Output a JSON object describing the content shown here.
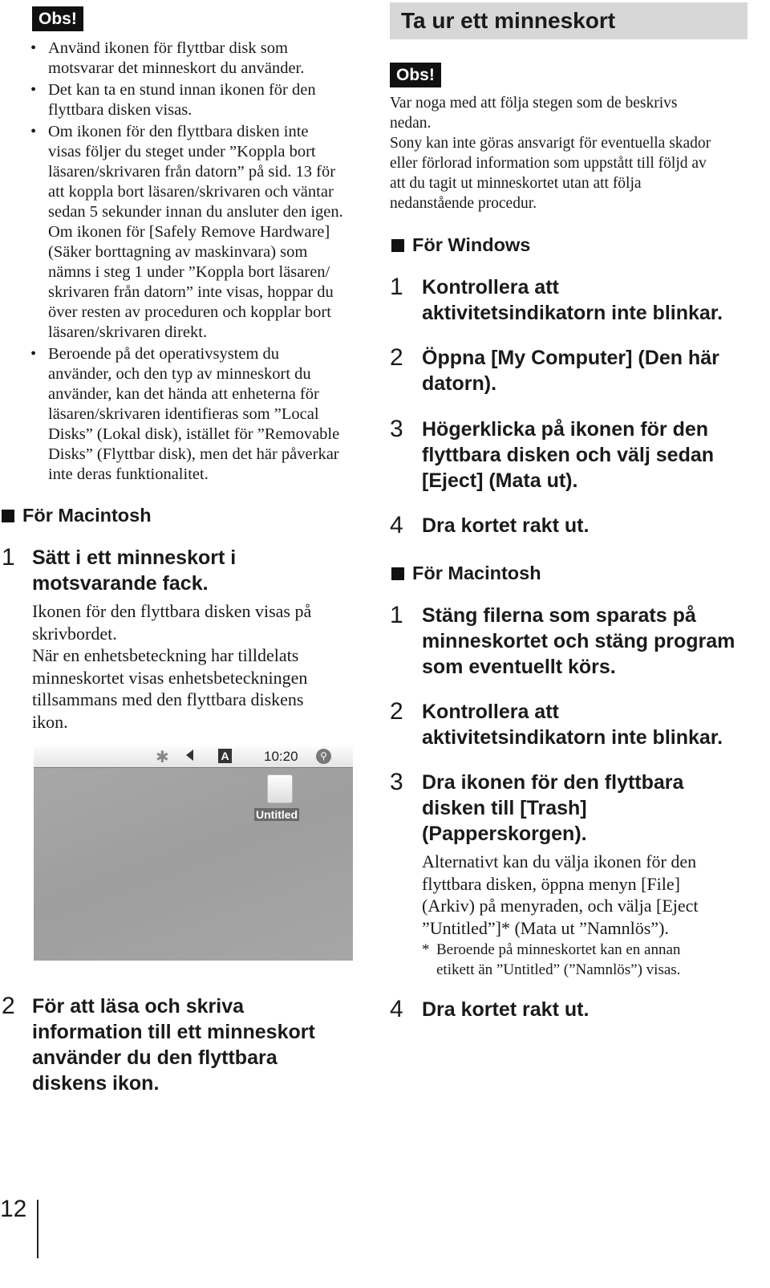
{
  "left": {
    "obs_label": "Obs!",
    "bullets": [
      [
        "Använd ikonen för flyttbar disk som",
        "motsvarar det minneskort du använder."
      ],
      [
        "Det kan ta en stund innan ikonen för den",
        "flyttbara disken visas."
      ],
      [
        "Om ikonen för den flyttbara disken inte",
        "visas följer du steget under ”Koppla bort",
        "läsaren/skrivaren från datorn” på sid. 13 för",
        "att koppla bort läsaren/skrivaren och väntar",
        "sedan 5 sekunder innan du ansluter den igen.",
        "Om ikonen för [Safely Remove Hardware]",
        "(Säker borttagning av maskinvara) som",
        "nämns i steg 1 under ”Koppla bort läsaren/",
        "skrivaren från datorn” inte visas, hoppar du",
        "över resten av proceduren och kopplar bort",
        "läsaren/skrivaren direkt."
      ],
      [
        "Beroende på det operativsystem du",
        "använder, och den typ av minneskort du",
        "använder, kan det hända att enheterna för",
        "läsaren/skrivaren identifieras som ”Local",
        "Disks” (Lokal disk), istället för ”Removable",
        "Disks” (Flyttbar disk), men det här påverkar",
        "inte deras funktionalitet."
      ]
    ],
    "mac_heading": "För Macintosh",
    "step1": {
      "num": "1",
      "title": [
        "Sätt i ett minneskort i",
        "motsvarande fack."
      ],
      "body": [
        "Ikonen för den flyttbara disken visas på",
        "skrivbordet.",
        "När en enhetsbeteckning har tilldelats",
        "minneskortet visas enhetsbeteckningen",
        "tillsammans med den flyttbara diskens",
        "ikon."
      ]
    },
    "screenshot": {
      "clock": "10:20",
      "input_menu": "A",
      "disk_label": "Untitled"
    },
    "step2": {
      "num": "2",
      "title": [
        "För att läsa och skriva",
        "information till ett minneskort",
        "använder du den flyttbara",
        "diskens ikon."
      ]
    }
  },
  "right": {
    "header": "Ta ur ett minneskort",
    "obs_label": "Obs!",
    "obs_text": [
      "Var noga med att följa stegen som de beskrivs",
      "nedan.",
      "Sony kan inte göras ansvarigt för eventuella skador",
      "eller förlorad information som uppstått till följd av",
      "att du tagit ut minneskortet utan att följa",
      "nedanstående procedur."
    ],
    "windows_heading": "För Windows",
    "windows_steps": [
      {
        "num": "1",
        "title": [
          "Kontrollera att",
          "aktivitetsindikatorn inte blinkar."
        ]
      },
      {
        "num": "2",
        "title": [
          "Öppna [My Computer] (Den här",
          "datorn)."
        ]
      },
      {
        "num": "3",
        "title": [
          "Högerklicka på ikonen för den",
          "flyttbara disken och välj sedan",
          "[Eject] (Mata ut)."
        ]
      },
      {
        "num": "4",
        "title": [
          "Dra kortet rakt ut."
        ]
      }
    ],
    "mac_heading": "För Macintosh",
    "mac_steps": [
      {
        "num": "1",
        "title": [
          "Stäng filerna som sparats på",
          "minneskortet och stäng program",
          "som eventuellt körs."
        ]
      },
      {
        "num": "2",
        "title": [
          "Kontrollera att",
          "aktivitetsindikatorn inte blinkar."
        ]
      },
      {
        "num": "3",
        "title": [
          "Dra ikonen för den flyttbara",
          "disken till [Trash]",
          "(Papperskorgen)."
        ],
        "body": [
          "Alternativt kan du välja ikonen för den",
          "flyttbara disken, öppna menyn [File]",
          "(Arkiv) på menyraden, och välja [Eject",
          "”Untitled”]* (Mata ut ”Namnlös”)."
        ],
        "note_mark": "*",
        "note": [
          "Beroende på minneskortet kan en annan",
          "etikett än ”Untitled” (”Namnlös”) visas."
        ]
      },
      {
        "num": "4",
        "title": [
          "Dra kortet rakt ut."
        ]
      }
    ]
  },
  "footer": {
    "page_number": "12"
  }
}
